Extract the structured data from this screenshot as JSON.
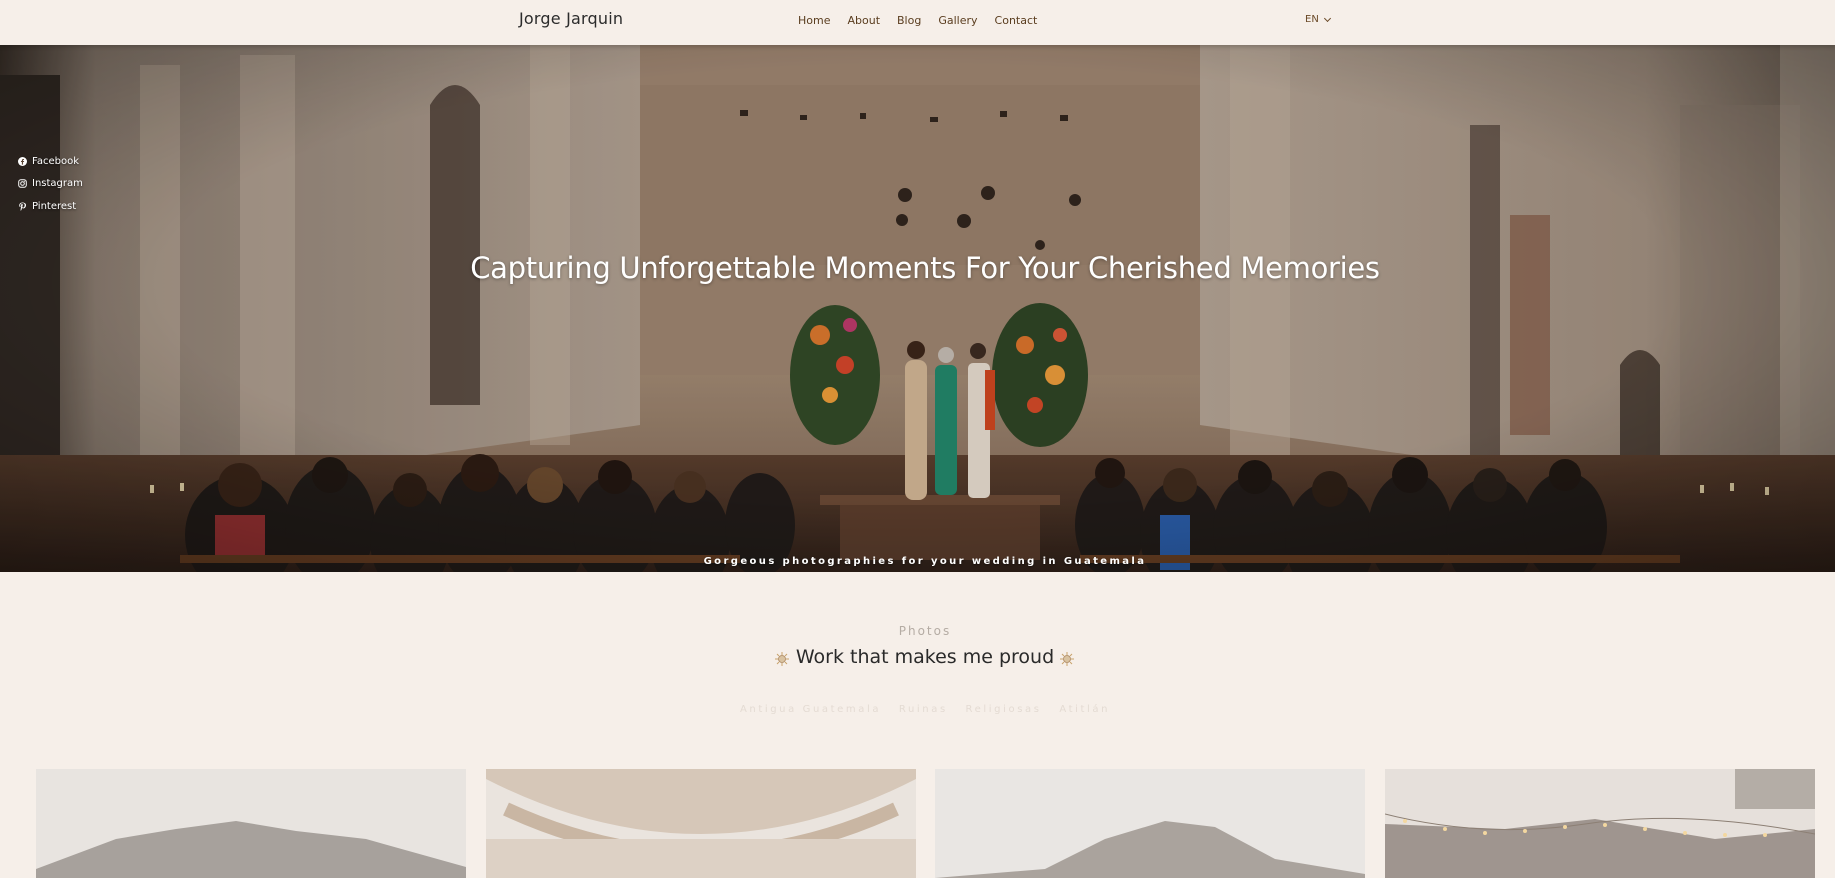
{
  "brand": "Jorge Jarquin",
  "nav": {
    "items": [
      "Home",
      "About",
      "Blog",
      "Gallery",
      "Contact"
    ],
    "language": "EN"
  },
  "social": {
    "items": [
      {
        "label": "Facebook",
        "icon": "facebook-icon"
      },
      {
        "label": "Instagram",
        "icon": "instagram-icon"
      },
      {
        "label": "Pinterest",
        "icon": "pinterest-icon"
      }
    ]
  },
  "hero": {
    "title": "Capturing Unforgettable Moments For Your Cherished Memories",
    "subtitle": "Gorgeous photographies for your wedding in Guatemala"
  },
  "photos": {
    "eyebrow": "Photos",
    "title": "Work that makes me proud",
    "filters": [
      "Antigua Guatemala",
      "Ruinas",
      "Religiosas",
      "Atitlán"
    ]
  },
  "colors": {
    "background": "#f6efe9",
    "nav_text": "#5a3d1f",
    "accent_sun": "#c9a36b"
  }
}
